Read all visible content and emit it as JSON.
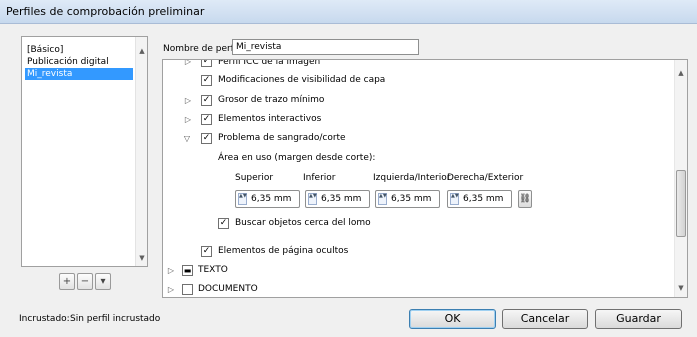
{
  "window": {
    "title": "Perfiles de comprobación preliminar"
  },
  "profiles": {
    "items": [
      {
        "label": "[Básico]"
      },
      {
        "label": "Publicación digital"
      },
      {
        "label": "Mi_revista"
      }
    ],
    "selected_index": 2
  },
  "profile_name": {
    "label": "Nombre de perfil:",
    "value": "Mi_revista"
  },
  "tree": {
    "rows": [
      {
        "label": "Perfil ICC de la imagen",
        "checked": true,
        "expander": "right"
      },
      {
        "label": "Modificaciones de visibilidad de capa",
        "checked": true,
        "expander": "none"
      },
      {
        "label": "Grosor de trazo mínimo",
        "checked": true,
        "expander": "right"
      },
      {
        "label": "Elementos interactivos",
        "checked": true,
        "expander": "right"
      },
      {
        "label": "Problema de sangrado/corte",
        "checked": true,
        "expander": "down"
      },
      {
        "label": "Elementos de página ocultos",
        "checked": true,
        "expander": "none"
      },
      {
        "label": "TEXTO",
        "checked": "partial",
        "expander": "right"
      },
      {
        "label": "DOCUMENTO",
        "checked": false,
        "expander": "right"
      }
    ],
    "bleed": {
      "area_label": "Área en uso (margen desde corte):",
      "headers": [
        "Superior",
        "Inferior",
        "Izquierda/Interior",
        "Derecha/Exterior"
      ],
      "values": [
        "6,35 mm",
        "6,35 mm",
        "6,35 mm",
        "6,35 mm"
      ],
      "spine_label": "Buscar objetos cerca del lomo",
      "spine_checked": true
    }
  },
  "footer": {
    "embedded_label": "Incrustado:",
    "embedded_value": "Sin perfil incrustado",
    "ok": "OK",
    "cancel": "Cancelar",
    "save": "Guardar"
  }
}
